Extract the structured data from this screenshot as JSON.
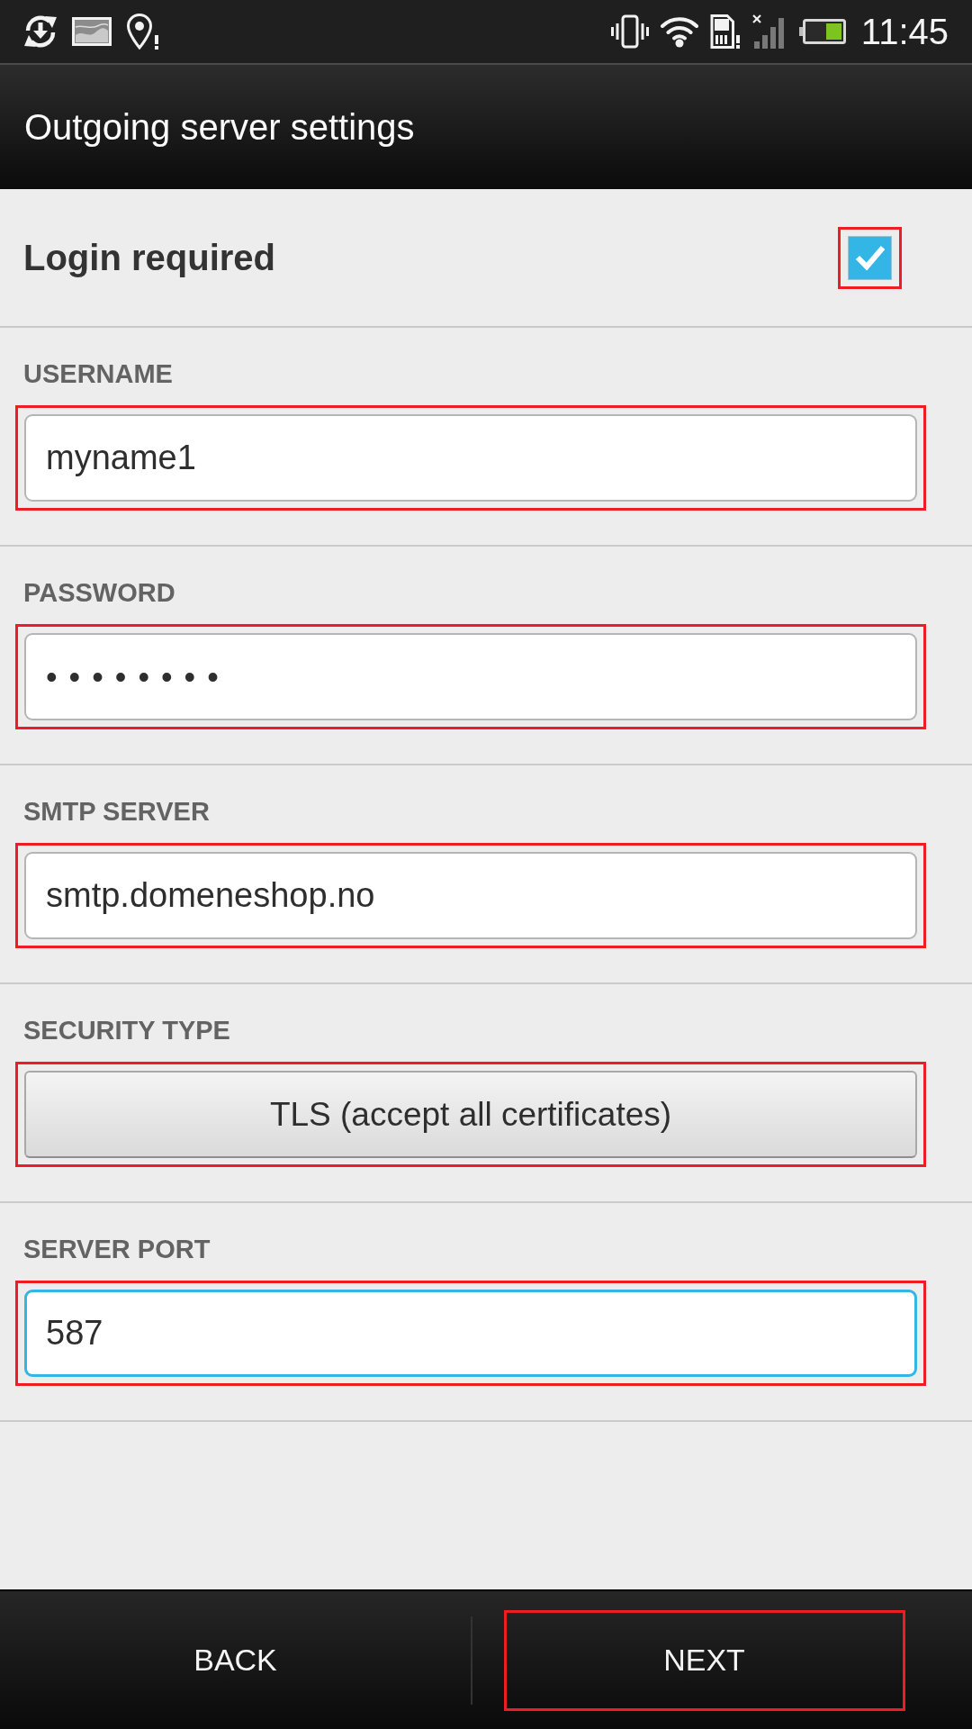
{
  "status_bar": {
    "time": "11:45"
  },
  "title_bar": {
    "title": "Outgoing server settings"
  },
  "login_required": {
    "label": "Login required",
    "checked": true,
    "highlighted": true
  },
  "fields": [
    {
      "kind": "text",
      "label": "USERNAME",
      "value": "myname1",
      "focused": false,
      "highlighted": true
    },
    {
      "kind": "password",
      "label": "PASSWORD",
      "value": "••••••••",
      "focused": false,
      "highlighted": true
    },
    {
      "kind": "text",
      "label": "SMTP SERVER",
      "value": "smtp.domeneshop.no",
      "focused": false,
      "highlighted": true
    },
    {
      "kind": "select",
      "label": "SECURITY TYPE",
      "value": "TLS (accept all certificates)",
      "focused": false,
      "highlighted": true
    },
    {
      "kind": "text",
      "label": "SERVER PORT",
      "value": "587",
      "focused": true,
      "highlighted": true
    }
  ],
  "buttons": [
    {
      "label": "BACK",
      "highlighted": false
    },
    {
      "label": "NEXT",
      "highlighted": true
    }
  ]
}
